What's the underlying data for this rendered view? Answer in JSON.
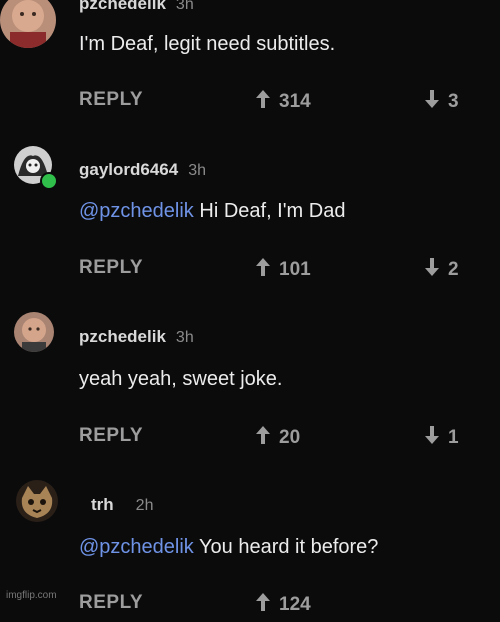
{
  "comments": [
    {
      "user": "pzchedelik",
      "time": "3h",
      "mention": "",
      "text": "I'm Deaf, legit need subtitles.",
      "reply": "REPLY",
      "upvotes": "314",
      "downvotes": "3"
    },
    {
      "user": "gaylord6464",
      "time": "3h",
      "mention": "@pzchedelik",
      "text": "Hi Deaf, I'm Dad",
      "reply": "REPLY",
      "upvotes": "101",
      "downvotes": "2"
    },
    {
      "user": "pzchedelik",
      "time": "3h",
      "mention": "",
      "text": "yeah yeah, sweet joke.",
      "reply": "REPLY",
      "upvotes": "20",
      "downvotes": "1"
    },
    {
      "user": "trh",
      "time": "2h",
      "mention": "@pzchedelik",
      "text": "You heard it before?",
      "reply": "REPLY",
      "upvotes": "124",
      "downvotes": ""
    }
  ],
  "icons": {
    "upvote": "arrow-up-icon",
    "downvote": "arrow-down-icon"
  },
  "colors": {
    "background": "#0b0b0c",
    "mention": "#6f93e6",
    "action_text": "#9d9d9d"
  },
  "watermark": "imgflip.com"
}
